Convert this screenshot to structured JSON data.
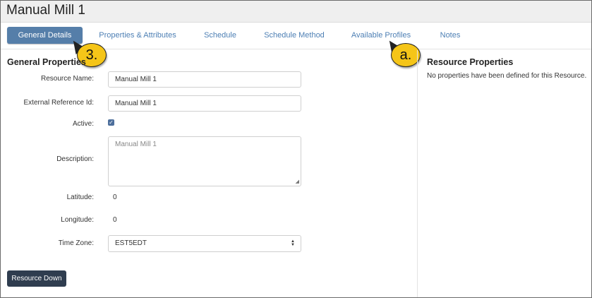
{
  "page": {
    "title": "Manual Mill 1"
  },
  "tabs": [
    {
      "label": "General Details"
    },
    {
      "label": "Properties & Attributes"
    },
    {
      "label": "Schedule"
    },
    {
      "label": "Schedule Method"
    },
    {
      "label": "Available Profiles"
    },
    {
      "label": "Notes"
    }
  ],
  "callouts": {
    "step": "3.",
    "profiles": "a."
  },
  "general": {
    "title": "General Properties",
    "fields": {
      "resource_name": {
        "label": "Resource Name:",
        "value": "Manual Mill 1"
      },
      "external_ref": {
        "label": "External Reference Id:",
        "value": "Manual Mill 1"
      },
      "active": {
        "label": "Active:",
        "checked": true
      },
      "description": {
        "label": "Description:",
        "placeholder": "Manual Mill 1"
      },
      "latitude": {
        "label": "Latitude:",
        "value": "0"
      },
      "longitude": {
        "label": "Longitude:",
        "value": "0"
      },
      "time_zone": {
        "label": "Time Zone:",
        "value": "EST5EDT"
      }
    },
    "resource_down_label": "Resource Down"
  },
  "resource_props": {
    "title": "Resource Properties",
    "empty_text": "No properties have been defined for this Resource."
  },
  "colors": {
    "accent": "#557ea9",
    "link": "#4d7fb4",
    "callout": "#f5c518",
    "dark_button": "#2f3d4f"
  }
}
